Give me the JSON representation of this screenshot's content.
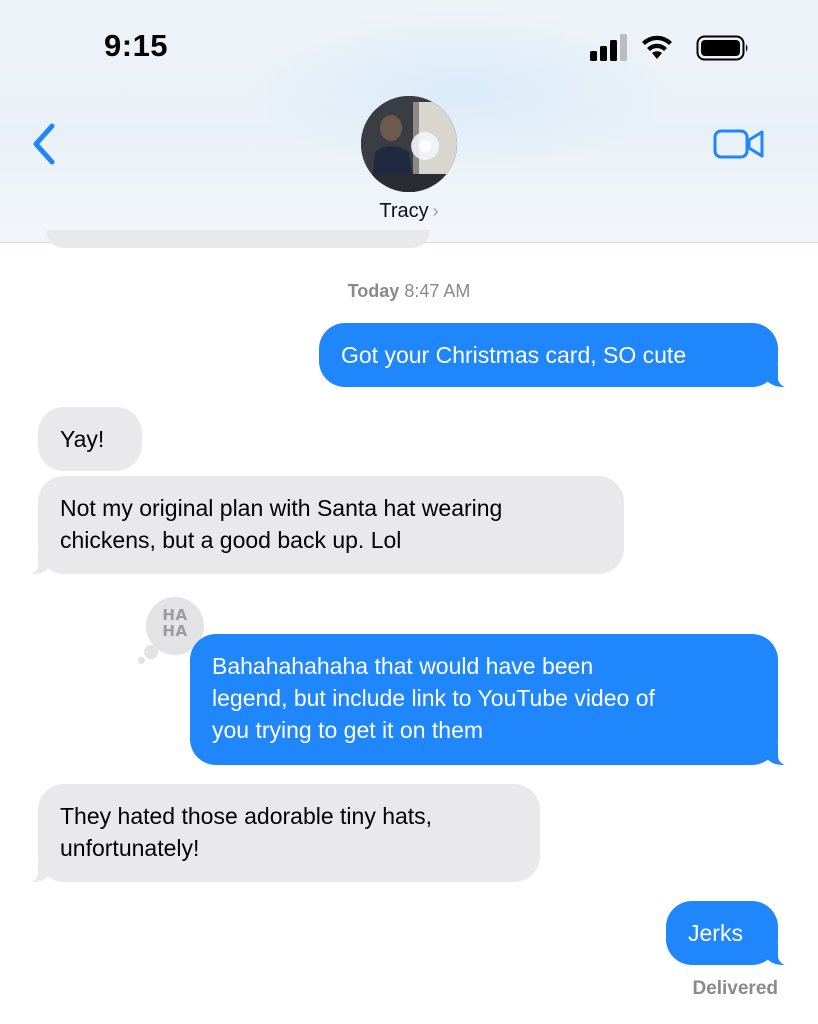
{
  "status_bar": {
    "time": "9:15",
    "icons": [
      "cellular-signal-icon",
      "wifi-icon",
      "battery-icon"
    ]
  },
  "header": {
    "contact_name": "Tracy",
    "chevron": "›",
    "back_icon": "chevron-left-icon",
    "video_icon": "video-camera-icon",
    "accent_color": "#1f87fb"
  },
  "conversation": {
    "timestamp_day": "Today",
    "timestamp_time": "8:47 AM",
    "messages": [
      {
        "direction": "sent",
        "text": "Got your Christmas card, SO cute"
      },
      {
        "direction": "received",
        "text": "Yay!"
      },
      {
        "direction": "received",
        "lines": [
          "Not my original plan with Santa hat wearing",
          "chickens, but a good back up. Lol"
        ]
      },
      {
        "direction": "sent",
        "lines": [
          "Bahahahahaha that would have been",
          "legend, but include link to YouTube video of",
          "you trying to get it on them"
        ],
        "tapback": "HA HA"
      },
      {
        "direction": "received",
        "lines": [
          "They hated those adorable tiny hats,",
          "unfortunately!"
        ]
      },
      {
        "direction": "sent",
        "text": "Jerks"
      }
    ],
    "tapback_lines": [
      "HA",
      "HA"
    ],
    "delivery_status": "Delivered"
  },
  "colors": {
    "sent_bubble": "#1f87fb",
    "received_bubble": "#e9e9eb",
    "meta_text": "#8a8a8e"
  }
}
